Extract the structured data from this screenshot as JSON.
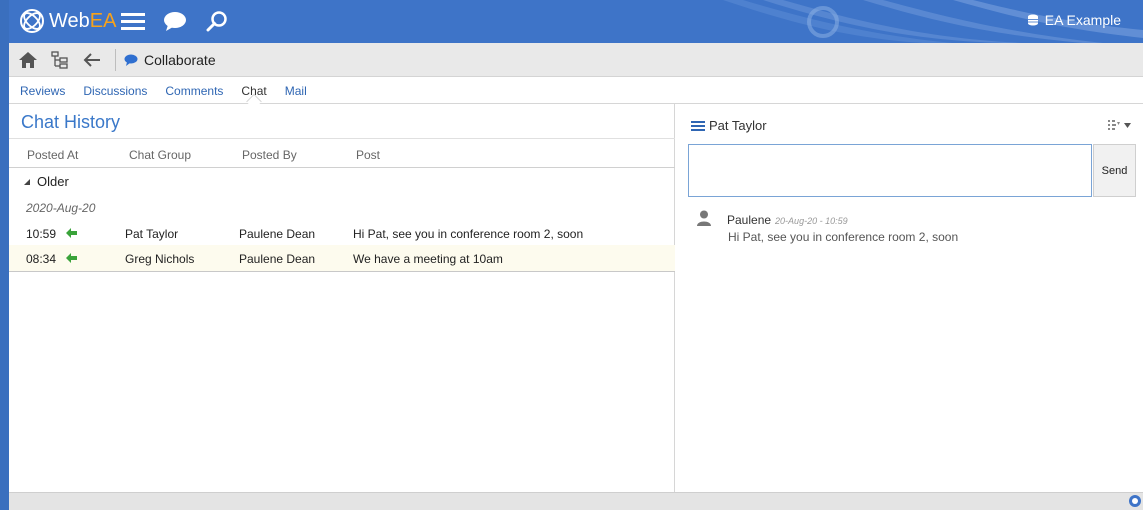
{
  "app": {
    "brand_web": "Web",
    "brand_ea": "EA",
    "repository": "EA Example"
  },
  "toolbar": {
    "breadcrumb_label": "Collaborate"
  },
  "tabs": [
    {
      "label": "Reviews"
    },
    {
      "label": "Discussions"
    },
    {
      "label": "Comments"
    },
    {
      "label": "Chat",
      "active": true
    },
    {
      "label": "Mail"
    }
  ],
  "chat_history": {
    "title": "Chat History",
    "columns": [
      "Posted At",
      "Chat Group",
      "Posted By",
      "Post"
    ],
    "group_label": "Older",
    "date_label": "2020-Aug-20",
    "rows": [
      {
        "time": "10:59",
        "group": "Pat Taylor",
        "by": "Paulene Dean",
        "post": "Hi Pat, see you in conference room 2, soon"
      },
      {
        "time": "08:34",
        "group": "Greg Nichols",
        "by": "Paulene Dean",
        "post": "We have a meeting at 10am"
      }
    ]
  },
  "chat_panel": {
    "recipient": "Pat Taylor",
    "input_value": "",
    "send_label": "Send",
    "messages": [
      {
        "author": "Paulene",
        "timestamp": "20-Aug-20 - 10:59",
        "text": "Hi Pat, see you in conference room 2, soon"
      }
    ]
  },
  "colors": {
    "header_blue": "#3e74c8",
    "accent_orange": "#f7a21b",
    "link_blue": "#2f66b3",
    "title_blue": "#3a78c9",
    "arrow_green": "#3aa33a"
  }
}
